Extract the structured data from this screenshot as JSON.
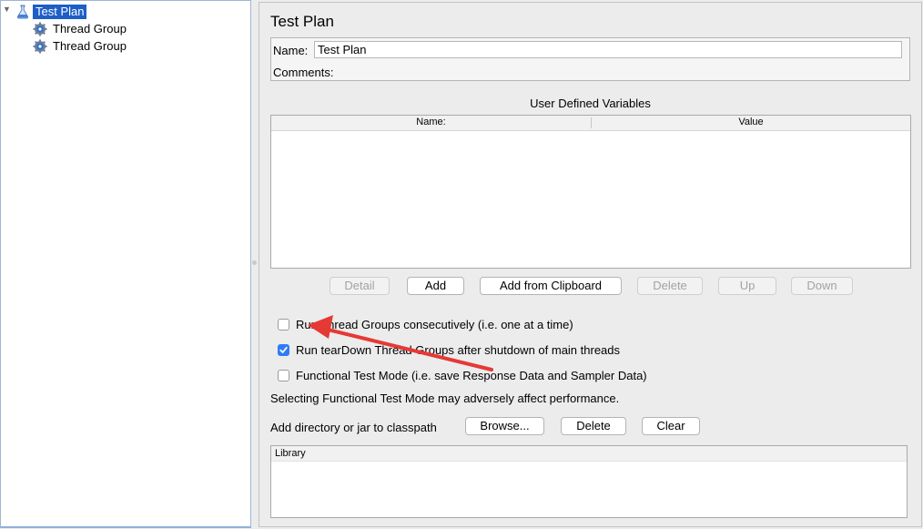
{
  "tree": {
    "root": {
      "label": "Test Plan"
    },
    "children": [
      {
        "label": "Thread Group"
      },
      {
        "label": "Thread Group"
      }
    ]
  },
  "panel": {
    "title": "Test Plan",
    "name_label": "Name:",
    "name_value": "Test Plan",
    "comments_label": "Comments:"
  },
  "udv": {
    "title": "User Defined Variables",
    "columns": [
      "Name:",
      "Value"
    ],
    "buttons": {
      "detail": "Detail",
      "add": "Add",
      "add_clipboard": "Add from Clipboard",
      "delete": "Delete",
      "up": "Up",
      "down": "Down"
    }
  },
  "options": {
    "consecutive": {
      "label": "Run Thread Groups consecutively (i.e. one at a time)",
      "checked": false
    },
    "teardown": {
      "label": "Run tearDown Thread Groups after shutdown of main threads",
      "checked": true
    },
    "functional": {
      "label": "Functional Test Mode (i.e. save Response Data and Sampler Data)",
      "checked": false
    }
  },
  "perf_note": "Selecting Functional Test Mode may adversely affect performance.",
  "classpath": {
    "label": "Add directory or jar to classpath",
    "browse": "Browse...",
    "delete": "Delete",
    "clear": "Clear",
    "library_column": "Library"
  },
  "colors": {
    "selection": "#1d5ec7",
    "checkbox_checked": "#2f7cf5",
    "annotation_arrow": "#e53935"
  }
}
